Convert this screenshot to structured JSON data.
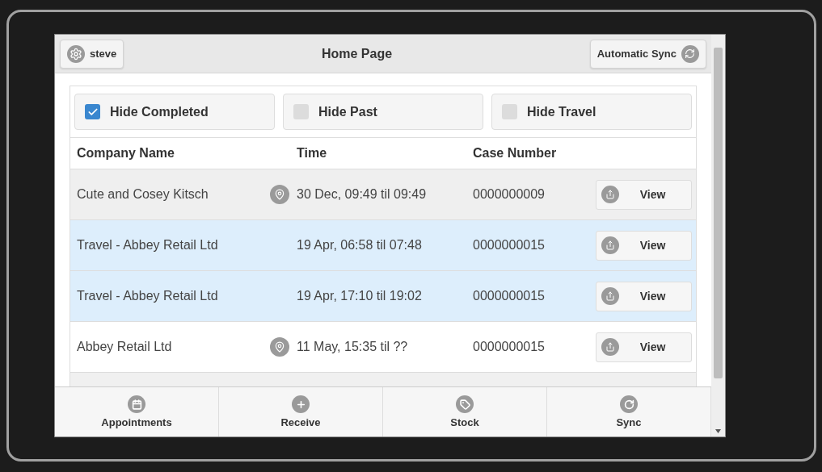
{
  "header": {
    "user_button": "steve",
    "title": "Home Page",
    "sync_button": "Automatic Sync"
  },
  "filters": [
    {
      "label": "Hide Completed",
      "checked": true
    },
    {
      "label": "Hide Past",
      "checked": false
    },
    {
      "label": "Hide Travel",
      "checked": false
    }
  ],
  "table": {
    "columns": [
      "Company Name",
      "Time",
      "Case Number"
    ],
    "rows": [
      {
        "kind": "appointment",
        "shaded": true,
        "company": "Cute and Cosey Kitsch",
        "time": "30 Dec, 09:49 til 09:49",
        "case": "0000000009",
        "action": "View"
      },
      {
        "kind": "travel",
        "company": "Travel - Abbey Retail Ltd",
        "time": "19 Apr, 06:58 til 07:48",
        "case": "0000000015",
        "action": "View"
      },
      {
        "kind": "travel",
        "company": "Travel - Abbey Retail Ltd",
        "time": "19 Apr, 17:10 til 19:02",
        "case": "0000000015",
        "action": "View"
      },
      {
        "kind": "appointment",
        "shaded": false,
        "company": "Abbey Retail Ltd",
        "time": "11 May, 15:35 til ??",
        "case": "0000000015",
        "action": "View"
      }
    ]
  },
  "footer_tabs": [
    {
      "kind": "calendar",
      "label": "Appointments"
    },
    {
      "kind": "plus",
      "label": "Receive"
    },
    {
      "kind": "tag",
      "label": "Stock"
    },
    {
      "kind": "sync",
      "label": "Sync"
    }
  ]
}
